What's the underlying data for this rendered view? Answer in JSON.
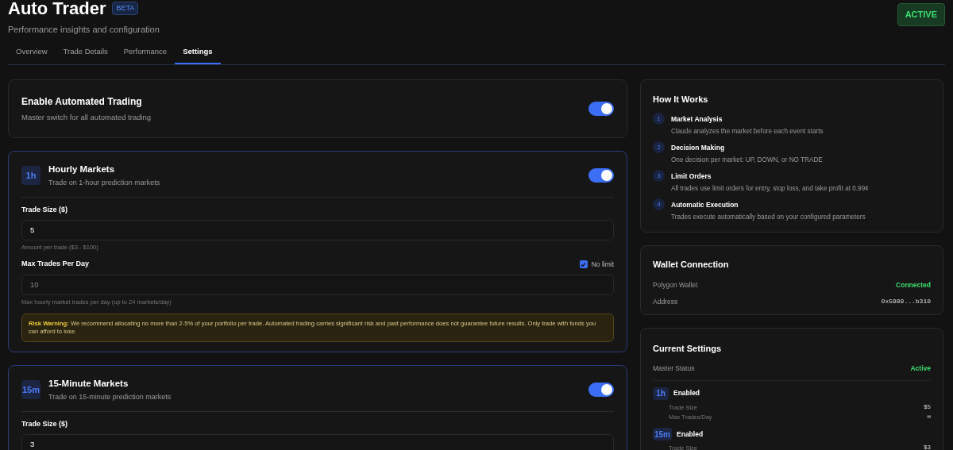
{
  "header": {
    "title": "Auto Trader",
    "badge": "BETA",
    "subtitle": "Performance insights and configuration",
    "status": "ACTIVE"
  },
  "tabs": [
    {
      "label": "Overview",
      "selected": false
    },
    {
      "label": "Trade Details",
      "selected": false
    },
    {
      "label": "Performance",
      "selected": false
    },
    {
      "label": "Settings",
      "selected": true
    }
  ],
  "master": {
    "title": "Enable Automated Trading",
    "description": "Master switch for all automated trading",
    "on": true
  },
  "markets": [
    {
      "badge": "1h",
      "title": "Hourly Markets",
      "description": "Trade on 1-hour prediction markets",
      "on": true,
      "fields": [
        {
          "label": "Trade Size ($)",
          "value": "5",
          "hint": "Amount per trade ($3 - $100)",
          "disabled": false
        },
        {
          "label": "Max Trades Per Day",
          "value": "10",
          "hint": "Max hourly market trades per day (up to 24 markets/day)",
          "disabled": true,
          "checkbox": {
            "label": "No limit",
            "checked": true
          }
        }
      ],
      "warning": "**Risk Warning:** We recommend allocating no more than 2-5% of your portfolio per trade. Automated trading carries significant risk and past performance does not guarantee future results. Only trade with funds you can afford to lose."
    },
    {
      "badge": "15m",
      "title": "15-Minute Markets",
      "description": "Trade on 15-minute prediction markets",
      "on": true,
      "fields": [
        {
          "label": "Trade Size ($)",
          "value": "3",
          "disabled": false
        }
      ]
    }
  ],
  "how_it_works": {
    "title": "How It Works",
    "steps": [
      {
        "number": "1",
        "title": "Market Analysis",
        "description": "Claude analyzes the market before each event starts"
      },
      {
        "number": "2",
        "title": "Decision Making",
        "description": "One decision per market: UP, DOWN, or NO TRADE"
      },
      {
        "number": "3",
        "title": "Limit Orders",
        "description": "All trades use limit orders for entry, stop loss, and take profit at 0.99¢"
      },
      {
        "number": "4",
        "title": "Automatic Execution",
        "description": "Trades execute automatically based on your configured parameters"
      }
    ]
  },
  "wallet": {
    "title": "Wallet Connection",
    "rows": [
      {
        "label": "Polygon Wallet",
        "value": "Connected",
        "kind": "status"
      },
      {
        "label": "Address",
        "value": "0x5989...b310",
        "kind": "mono"
      }
    ]
  },
  "current_settings": {
    "title": "Current Settings",
    "master": {
      "label": "Master Status",
      "value": "Active"
    },
    "groups": [
      {
        "badge": "1h",
        "status": "Enabled",
        "rows": [
          {
            "label": "Trade Size",
            "value": "$5"
          },
          {
            "label": "Max Trades/Day",
            "value": "∞"
          }
        ]
      },
      {
        "badge": "15m",
        "status": "Enabled",
        "rows": [
          {
            "label": "Trade Size",
            "value": "$3"
          }
        ]
      }
    ]
  }
}
